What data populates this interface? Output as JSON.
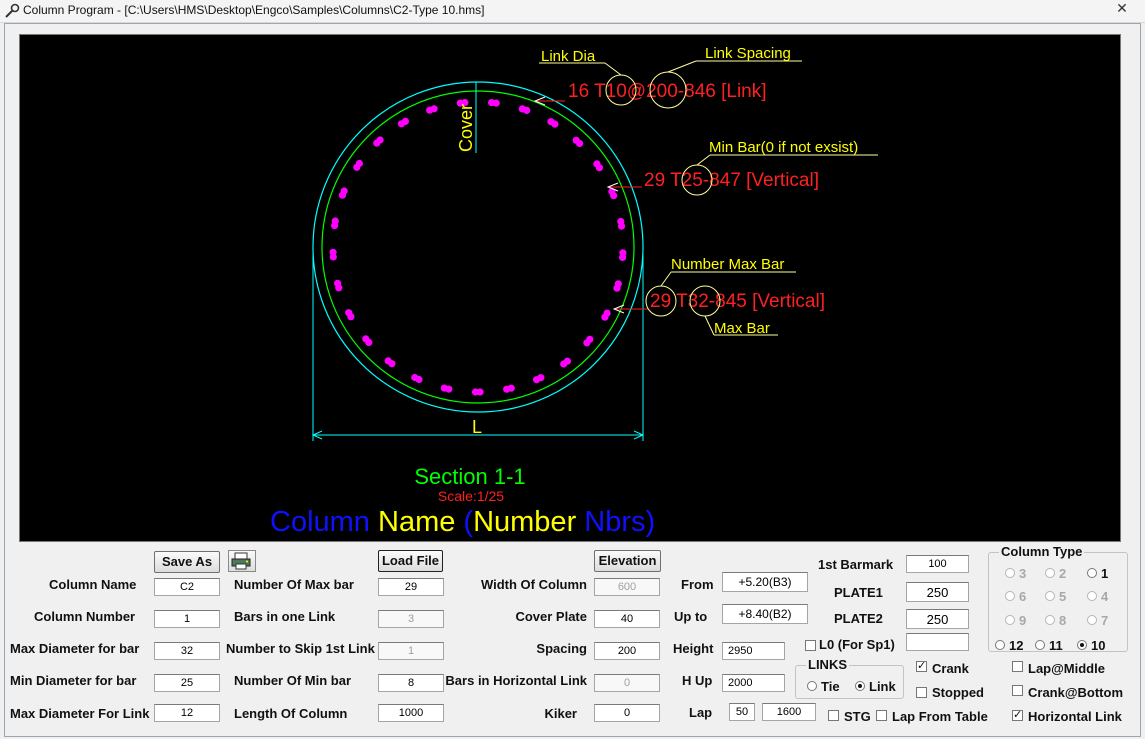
{
  "window": {
    "title": "Column Program - [C:\\Users\\HMS\\Desktop\\Engco\\Samples\\Columns\\C2-Type 10.hms]",
    "close_label": "✕"
  },
  "drawing": {
    "link_dia_label": "Link Dia",
    "link_spacing_label": "Link Spacing",
    "link_callout": "16 T10@200-846 [Link]",
    "cover_label": "Cover",
    "min_bar_label": "Min Bar(0 if not exsist)",
    "min_bar_callout": "29 T25-847 [Vertical]",
    "number_max_bar_label": "Number Max Bar",
    "max_bar_callout": "29 T32-845 [Vertical]",
    "max_bar_label": "Max Bar",
    "dim_label": "L",
    "section_title": "Section 1-1",
    "scale": "Scale:1/25",
    "name_part1": "Column ",
    "name_part2": "Name",
    "name_part3": " (",
    "name_part4": "Number",
    "name_part5": " Nbrs)",
    "bar_count": 29,
    "colors": {
      "bar": "#ff00ff",
      "link": "#00ff00",
      "outline": "#00ffff",
      "callout": "#ff2020",
      "label": "#ffff00",
      "section": "#00ff00",
      "name_blue": "#1010ff",
      "name_yellow": "#ffff00"
    }
  },
  "buttons": {
    "save_as": "Save As",
    "load_file": "Load File",
    "elevation": "Elevation"
  },
  "col1": {
    "column_name": {
      "label": "Column Name",
      "value": "C2"
    },
    "column_number": {
      "label": "Column Number",
      "value": "1"
    },
    "max_dia_bar": {
      "label": "Max Diameter for bar",
      "value": "32"
    },
    "min_dia_bar": {
      "label": "Min Diameter for bar",
      "value": "25"
    },
    "max_dia_link": {
      "label": "Max Diameter For Link",
      "value": "12"
    }
  },
  "col2": {
    "num_max_bar": {
      "label": "Number Of Max bar",
      "value": "29"
    },
    "bars_in_link": {
      "label": "Bars in one Link",
      "value": "3"
    },
    "skip_first_link": {
      "label": "Number to Skip 1st Link",
      "value": "1"
    },
    "num_min_bar": {
      "label": "Number Of Min bar",
      "value": "8"
    },
    "length_column": {
      "label": "Length Of Column",
      "value": "1000"
    }
  },
  "col3": {
    "width_column": {
      "label": "Width Of Column",
      "value": "600"
    },
    "cover_plate": {
      "label": "Cover Plate",
      "value": "40"
    },
    "spacing": {
      "label": "Spacing",
      "value": "200"
    },
    "bars_horizontal_link": {
      "label": "Bars in Horizontal Link",
      "value": "0"
    },
    "kiker": {
      "label": "Kiker",
      "value": "0"
    }
  },
  "col4": {
    "from": {
      "label": "From",
      "value": "+5.20(B3)"
    },
    "up_to": {
      "label": "Up to",
      "value": "+8.40(B2)"
    },
    "height": {
      "label": "Height",
      "value": "2950"
    },
    "h_up": {
      "label": "H Up",
      "value": "2000"
    },
    "lap": {
      "label": "Lap",
      "value1": "50",
      "value2": "1600"
    }
  },
  "col5": {
    "first_barmark": {
      "label": "1st Barmark",
      "value": "100"
    },
    "plate1": {
      "label": "PLATE1",
      "value": "250"
    },
    "plate2": {
      "label": "PLATE2",
      "value": "250"
    },
    "l0": {
      "label": "L0 (For Sp1)",
      "value": ""
    }
  },
  "links": {
    "caption": "LINKS",
    "tie": "Tie",
    "link": "Link"
  },
  "checks": {
    "crank": "Crank",
    "stopped": "Stopped",
    "stg": "STG",
    "lap_from_table": "Lap From Table",
    "lap_middle": "Lap@Middle",
    "crank_bottom": "Crank@Bottom",
    "horizontal_link": "Horizontal Link",
    "check_mark": "✓"
  },
  "column_type": {
    "caption": "Column Type",
    "options": [
      "3",
      "2",
      "1",
      "6",
      "5",
      "4",
      "9",
      "8",
      "7",
      "12",
      "11",
      "10"
    ],
    "selected": "10"
  }
}
